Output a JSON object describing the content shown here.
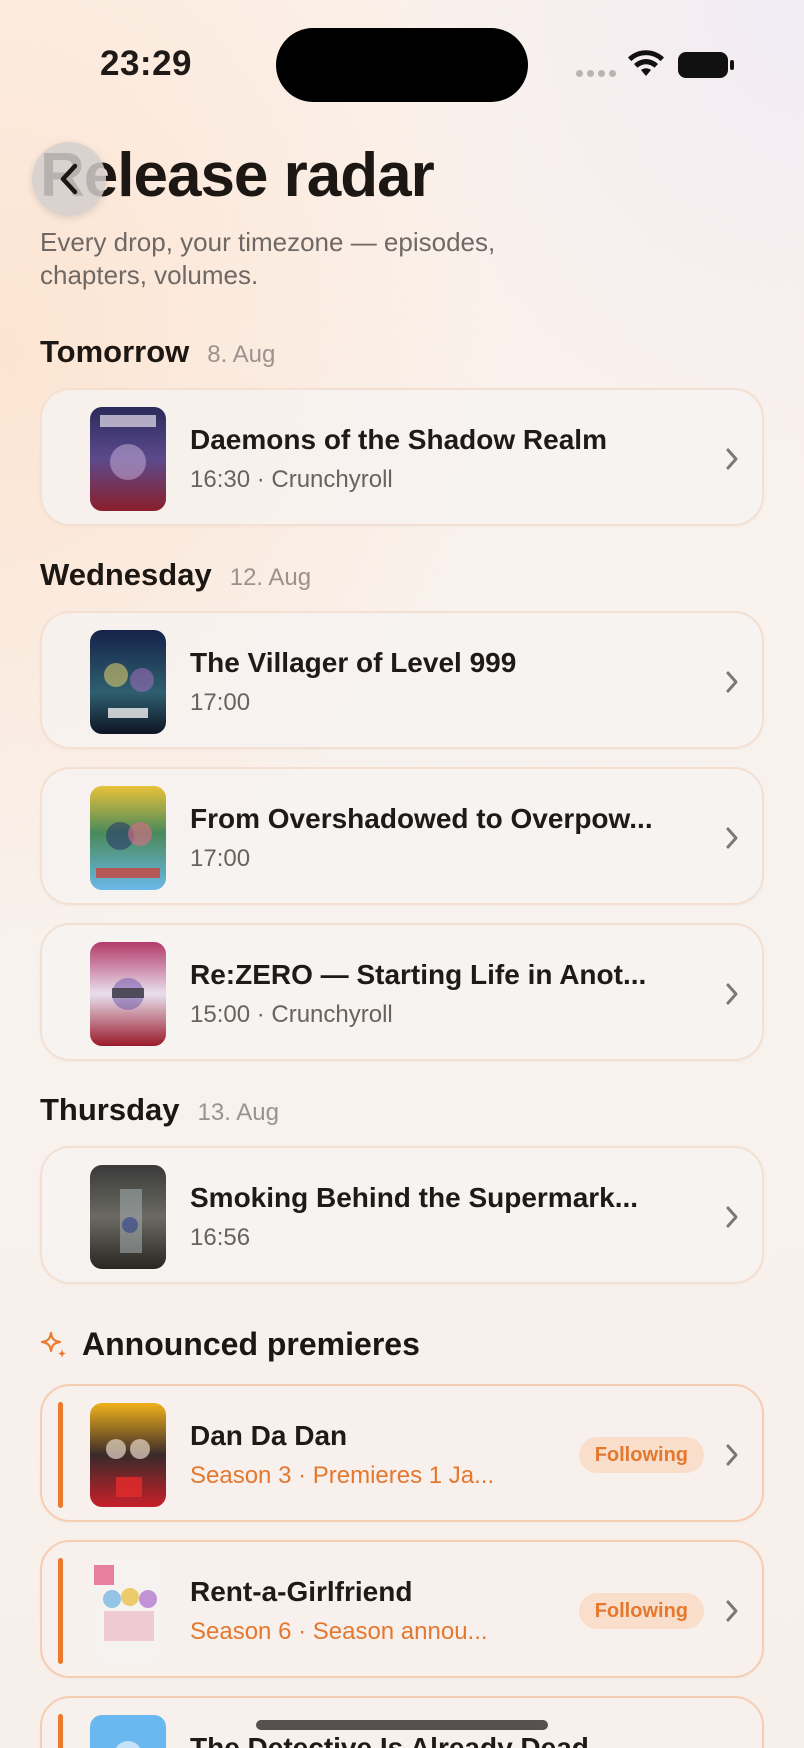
{
  "status_bar": {
    "time": "23:29"
  },
  "header": {
    "title": "Release radar",
    "subtitle": "Every drop, your timezone — episodes, chapters, volumes."
  },
  "sections": [
    {
      "day": "Tomorrow",
      "date": "8. Aug",
      "items": [
        {
          "title": "Daemons of the Shadow Realm",
          "sub": "16:30 · Crunchyroll"
        }
      ]
    },
    {
      "day": "Wednesday",
      "date": "12. Aug",
      "items": [
        {
          "title": "The Villager of Level 999",
          "sub": "17:00"
        },
        {
          "title": "From Overshadowed to Overpow...",
          "sub": "17:00"
        },
        {
          "title": "Re:ZERO — Starting Life in Anot...",
          "sub": "15:00 · Crunchyroll"
        }
      ]
    },
    {
      "day": "Thursday",
      "date": "13. Aug",
      "items": [
        {
          "title": "Smoking Behind the Supermark...",
          "sub": "16:56"
        }
      ]
    }
  ],
  "premieres": {
    "title": "Announced premieres",
    "items": [
      {
        "title": "Dan Da Dan",
        "sub": "Season 3 · Premieres 1 Ja...",
        "badge": "Following"
      },
      {
        "title": "Rent-a-Girlfriend",
        "sub": "Season 6 · Season annou...",
        "badge": "Following"
      },
      {
        "title": "The Detective Is Already Dead",
        "sub": ""
      }
    ]
  },
  "colors": {
    "accent": "#e3782e",
    "accent_bar": "#ec7a2e",
    "badge_bg": "#f8dcc8"
  }
}
